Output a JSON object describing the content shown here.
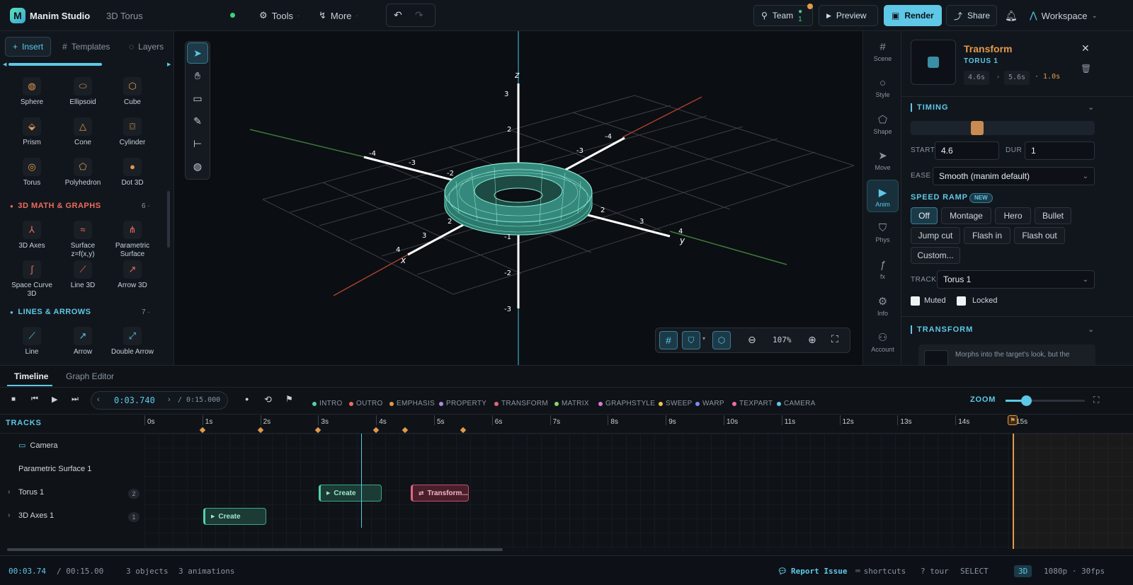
{
  "app": {
    "name": "Manim Studio",
    "project": "3D Torus",
    "menus": [
      "Tools",
      "More"
    ],
    "team": {
      "label": "Team",
      "count": "1"
    },
    "actions": {
      "preview": "Preview",
      "render": "Render",
      "share": "Share",
      "workspace": "Workspace"
    }
  },
  "left": {
    "tabs": [
      "Insert",
      "Templates",
      "Layers"
    ],
    "shapes": [
      {
        "label": "Sphere",
        "icon": "sphere-icon"
      },
      {
        "label": "Ellipsoid",
        "icon": "ellipsoid-icon"
      },
      {
        "label": "Cube",
        "icon": "cube-icon"
      },
      {
        "label": "Prism",
        "icon": "prism-icon"
      },
      {
        "label": "Cone",
        "icon": "cone-icon"
      },
      {
        "label": "Cylinder",
        "icon": "cylinder-icon"
      },
      {
        "label": "Torus",
        "icon": "torus-icon"
      },
      {
        "label": "Polyhedron",
        "icon": "polyhedron-icon"
      },
      {
        "label": "Dot 3D",
        "icon": "dot-icon"
      }
    ],
    "math_section": {
      "title": "3D MATH & GRAPHS",
      "count": "6"
    },
    "math": [
      {
        "label": "3D Axes"
      },
      {
        "label": "Surface z=f(x,y)"
      },
      {
        "label": "Parametric Surface"
      },
      {
        "label": "Space Curve 3D"
      },
      {
        "label": "Line 3D"
      },
      {
        "label": "Arrow 3D"
      }
    ],
    "lines_section": {
      "title": "LINES & ARROWS",
      "count": "7"
    },
    "lines": [
      {
        "label": "Line"
      },
      {
        "label": "Arrow"
      },
      {
        "label": "Double Arrow"
      }
    ]
  },
  "viewport": {
    "axes": {
      "x": "x",
      "y": "y",
      "z": "z"
    },
    "zoom": "107%"
  },
  "rail": [
    "Scene",
    "Style",
    "Shape",
    "Move",
    "Anim",
    "Phys",
    "fx",
    "Info",
    "Account"
  ],
  "inspector": {
    "title": "Transform",
    "target": "TORUS 1",
    "time_from": "4.6s",
    "time_to": "5.6s",
    "duration": "· 1.0s",
    "timing": {
      "title": "TIMING",
      "slider_position": 0.35,
      "start_label": "START",
      "start": "4.6",
      "dur_label": "DUR",
      "dur": "1",
      "ease_label": "EASE",
      "ease": "Smooth (manim default)"
    },
    "speed_ramp": {
      "title": "SPEED RAMP",
      "badge": "NEW",
      "options": [
        "Off",
        "Montage",
        "Hero",
        "Bullet",
        "Jump cut",
        "Flash in",
        "Flash out",
        "Custom..."
      ],
      "selected": "Off"
    },
    "track_label": "TRACK",
    "track": "Torus 1",
    "muted": "Muted",
    "locked": "Locked",
    "transform_section": "TRANSFORM",
    "transform_hint": "Morphs into the target's look, but the"
  },
  "timeline": {
    "tabs": [
      "Timeline",
      "Graph Editor"
    ],
    "current": "0:03.740",
    "total": "/ 0:15.000",
    "categories": [
      {
        "label": "INTRO",
        "color": "#4fd1ac"
      },
      {
        "label": "OUTRO",
        "color": "#f06b5b"
      },
      {
        "label": "EMPHASIS",
        "color": "#e39a4a"
      },
      {
        "label": "PROPERTY",
        "color": "#b48ae0"
      },
      {
        "label": "TRANSFORM",
        "color": "#e0667f"
      },
      {
        "label": "MATRIX",
        "color": "#8bd46b"
      },
      {
        "label": "GRAPHSTYLE",
        "color": "#d97ad9"
      },
      {
        "label": "SWEEP",
        "color": "#f2c14e"
      },
      {
        "label": "WARP",
        "color": "#7b8cf0"
      },
      {
        "label": "TEXPART",
        "color": "#f06ba8"
      },
      {
        "label": "CAMERA",
        "color": "#5ec8e6"
      }
    ],
    "zoom_label": "ZOOM",
    "tracks_label": "TRACKS",
    "ruler": [
      "0s",
      "1s",
      "2s",
      "3s",
      "4s",
      "5s",
      "6s",
      "7s",
      "8s",
      "9s",
      "10s",
      "11s",
      "12s",
      "13s",
      "14s",
      "15s"
    ],
    "tracks": [
      {
        "name": "Camera",
        "count": ""
      },
      {
        "name": "Parametric Surface 1",
        "count": ""
      },
      {
        "name": "Torus 1",
        "count": "2"
      },
      {
        "name": "3D Axes 1",
        "count": "1"
      }
    ],
    "clips": {
      "torus_create": "Create",
      "torus_transform": "Transform...",
      "axes_create": "Create"
    }
  },
  "status": {
    "time": "00:03.74",
    "total": "/ 00:15.00",
    "objects": "3 objects",
    "animations": "3 animations",
    "report": "Report Issue",
    "shortcuts": "shortcuts",
    "tour": "? tour",
    "mode": "SELECT",
    "dim": "3D",
    "format": "1080p · 30fps"
  }
}
